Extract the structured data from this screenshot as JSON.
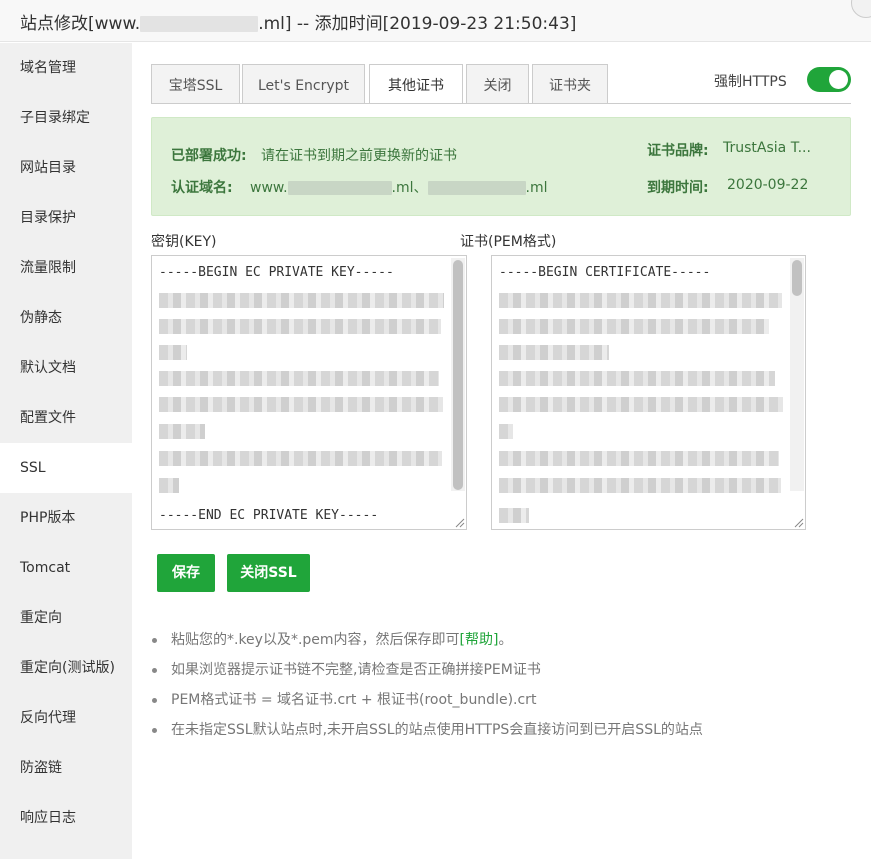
{
  "window": {
    "title": "站点修改[www.",
    "title_tail": ".ml] -- 添加时间[2019-09-23 21:50:43]"
  },
  "sidebar": {
    "items": [
      {
        "label": "域名管理"
      },
      {
        "label": "子目录绑定"
      },
      {
        "label": "网站目录"
      },
      {
        "label": "目录保护"
      },
      {
        "label": "流量限制"
      },
      {
        "label": "伪静态"
      },
      {
        "label": "默认文档"
      },
      {
        "label": "配置文件"
      },
      {
        "label": "SSL"
      },
      {
        "label": "PHP版本"
      },
      {
        "label": "Tomcat"
      },
      {
        "label": "重定向"
      },
      {
        "label": "重定向(测试版)"
      },
      {
        "label": "反向代理"
      },
      {
        "label": "防盗链"
      },
      {
        "label": "响应日志"
      }
    ],
    "active": "SSL"
  },
  "tabs": [
    {
      "label": "宝塔SSL"
    },
    {
      "label": "Let's Encrypt"
    },
    {
      "label": "其他证书"
    },
    {
      "label": "关闭"
    },
    {
      "label": "证书夹"
    }
  ],
  "active_tab": "其他证书",
  "force_https": {
    "label": "强制HTTPS",
    "enabled": true
  },
  "status": {
    "deployed_label": "已部署成功:",
    "deployed_text": "请在证书到期之前更换新的证书",
    "domain_label": "认证域名:",
    "domain_prefix": "www.",
    "domain_mid": ".ml、",
    "domain_tail": ".ml",
    "brand_label": "证书品牌:",
    "brand_value": "TrustAsia T...",
    "expiry_label": "到期时间:",
    "expiry_value": "2020-09-22"
  },
  "key_pane": {
    "label": "密钥(KEY)",
    "begin": "-----BEGIN EC PRIVATE KEY-----",
    "end": "-----END EC PRIVATE KEY-----"
  },
  "cert_pane": {
    "label": "证书(PEM格式)",
    "begin": "-----BEGIN CERTIFICATE-----"
  },
  "buttons": {
    "save": "保存",
    "close_ssl": "关闭SSL"
  },
  "tips": {
    "tip1_pre": "粘贴您的*.key以及*.pem内容，然后保存即可",
    "tip1_link": "[帮助]",
    "tip1_post": "。",
    "tip2": "如果浏览器提示证书链不完整,请检查是否正确拼接PEM证书",
    "tip3": "PEM格式证书 = 域名证书.crt + 根证书(root_bundle).crt",
    "tip4": "在未指定SSL默认站点时,未开启SSL的站点使用HTTPS会直接访问到已开启SSL的站点"
  },
  "colors": {
    "accent": "#20a53a",
    "success_bg": "#dff0d8",
    "success_text": "#3c763d"
  }
}
